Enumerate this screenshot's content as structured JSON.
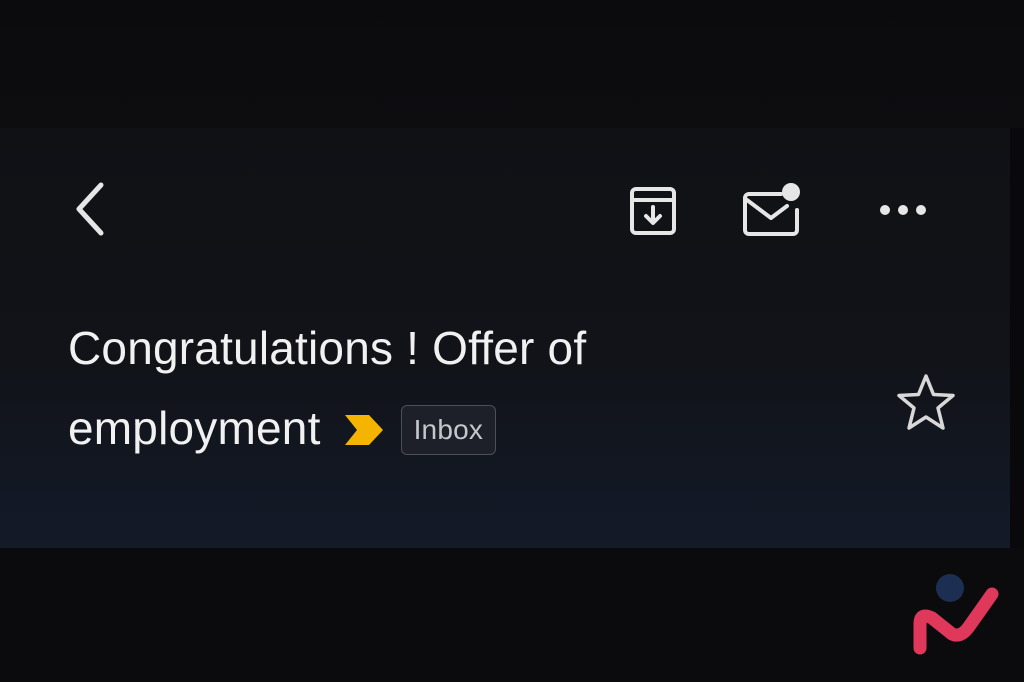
{
  "toolbar": {
    "back_icon": "chevron-left-icon",
    "archive_icon": "archive-icon",
    "mark_unread_icon": "mail-unread-icon",
    "more_icon": "more-horizontal-icon"
  },
  "email": {
    "subject_line1": "Congratulations ! Offer of",
    "subject_line2": "employment",
    "importance_icon": "importance-marker-icon",
    "label": "Inbox",
    "star_icon": "star-outline-icon"
  },
  "colors": {
    "icon": "#e6e6e6",
    "importance_marker": "#f4b400",
    "logo_pink": "#e0385a",
    "logo_navy": "#1c2f52"
  }
}
